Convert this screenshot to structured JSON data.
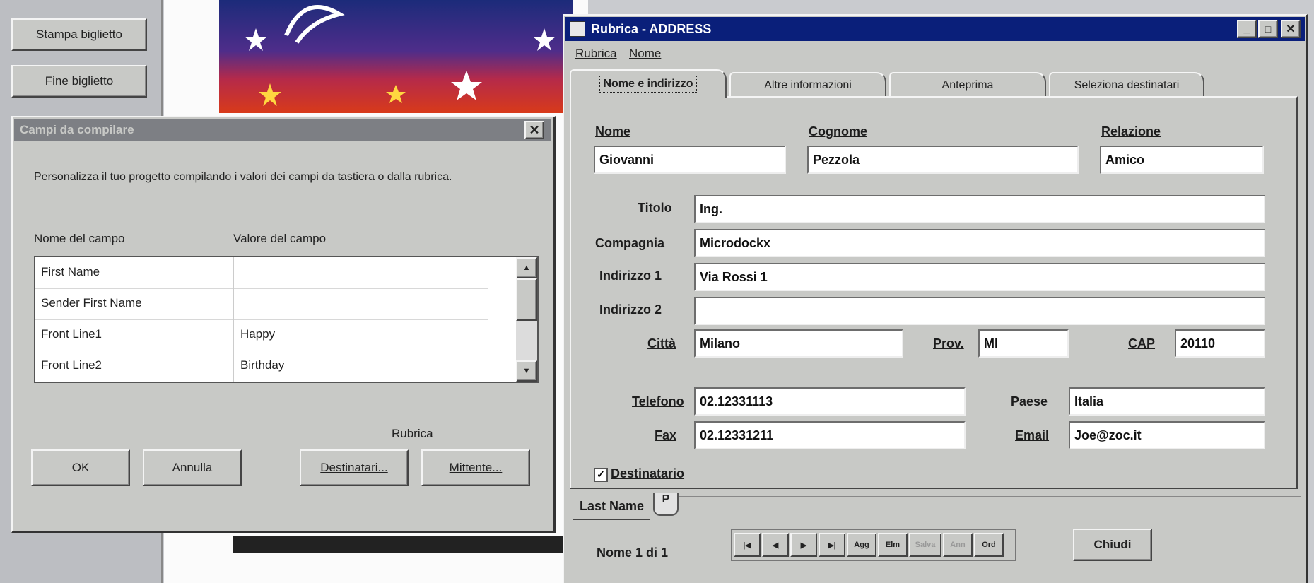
{
  "left_app": {
    "buttons": [
      "Stampa biglietto",
      "Fine biglietto"
    ]
  },
  "dialog_campi": {
    "title": "Campi da compilare",
    "instructions": "Personalizza il tuo progetto compilando i valori dei campi da tastiera o dalla rubrica.",
    "column_name_header": "Nome del campo",
    "column_value_header": "Valore del campo",
    "rows": [
      {
        "name": "First Name",
        "value": ""
      },
      {
        "name": "Sender First Name",
        "value": ""
      },
      {
        "name": "Front Line1",
        "value": "Happy"
      },
      {
        "name": "Front Line2",
        "value": "Birthday"
      }
    ],
    "rubrica_label": "Rubrica",
    "ok_label": "OK",
    "cancel_label": "Annulla",
    "recipients_label": "Destinatari...",
    "sender_label": "Mittente..."
  },
  "rubrica_window": {
    "title": "Rubrica - ADDRESS",
    "menu": [
      "Rubrica",
      "Nome"
    ],
    "tabs": [
      "Nome e indirizzo",
      "Altre informazioni",
      "Anteprima",
      "Seleziona destinatari"
    ],
    "fields": {
      "nome": {
        "label": "Nome",
        "value": "Giovanni"
      },
      "cognome": {
        "label": "Cognome",
        "value": "Pezzola"
      },
      "relazione": {
        "label": "Relazione",
        "value": "Amico"
      },
      "titolo": {
        "label": "Titolo",
        "value": "Ing."
      },
      "compagnia": {
        "label": "Compagnia",
        "value": "Microdockx"
      },
      "indirizzo1": {
        "label": "Indirizzo 1",
        "value": "Via Rossi 1"
      },
      "indirizzo2": {
        "label": "Indirizzo 2",
        "value": ""
      },
      "citta": {
        "label": "Città",
        "value": "Milano"
      },
      "prov": {
        "label": "Prov.",
        "value": "MI"
      },
      "cap": {
        "label": "CAP",
        "value": "20110"
      },
      "telefono": {
        "label": "Telefono",
        "value": "02.12331113"
      },
      "paese": {
        "label": "Paese",
        "value": "Italia"
      },
      "fax": {
        "label": "Fax",
        "value": "02.12331211"
      },
      "email": {
        "label": "Email",
        "value": "Joe@zoc.it"
      }
    },
    "checkbox_label": "Destinatario",
    "bottom_tabs": [
      "Last Name",
      "P"
    ],
    "record_status": "Nome 1 di 1",
    "nav_buttons": [
      "|◀",
      "◀",
      "▶",
      "▶|",
      "Agg",
      "Elm",
      "Salva",
      "Ann",
      "Ord"
    ],
    "close_label": "Chiudi"
  },
  "colors": {
    "titlebar": "#0a1f7a",
    "inactive_titlebar": "#7d7f84",
    "window_bg": "#c8c9c6"
  }
}
